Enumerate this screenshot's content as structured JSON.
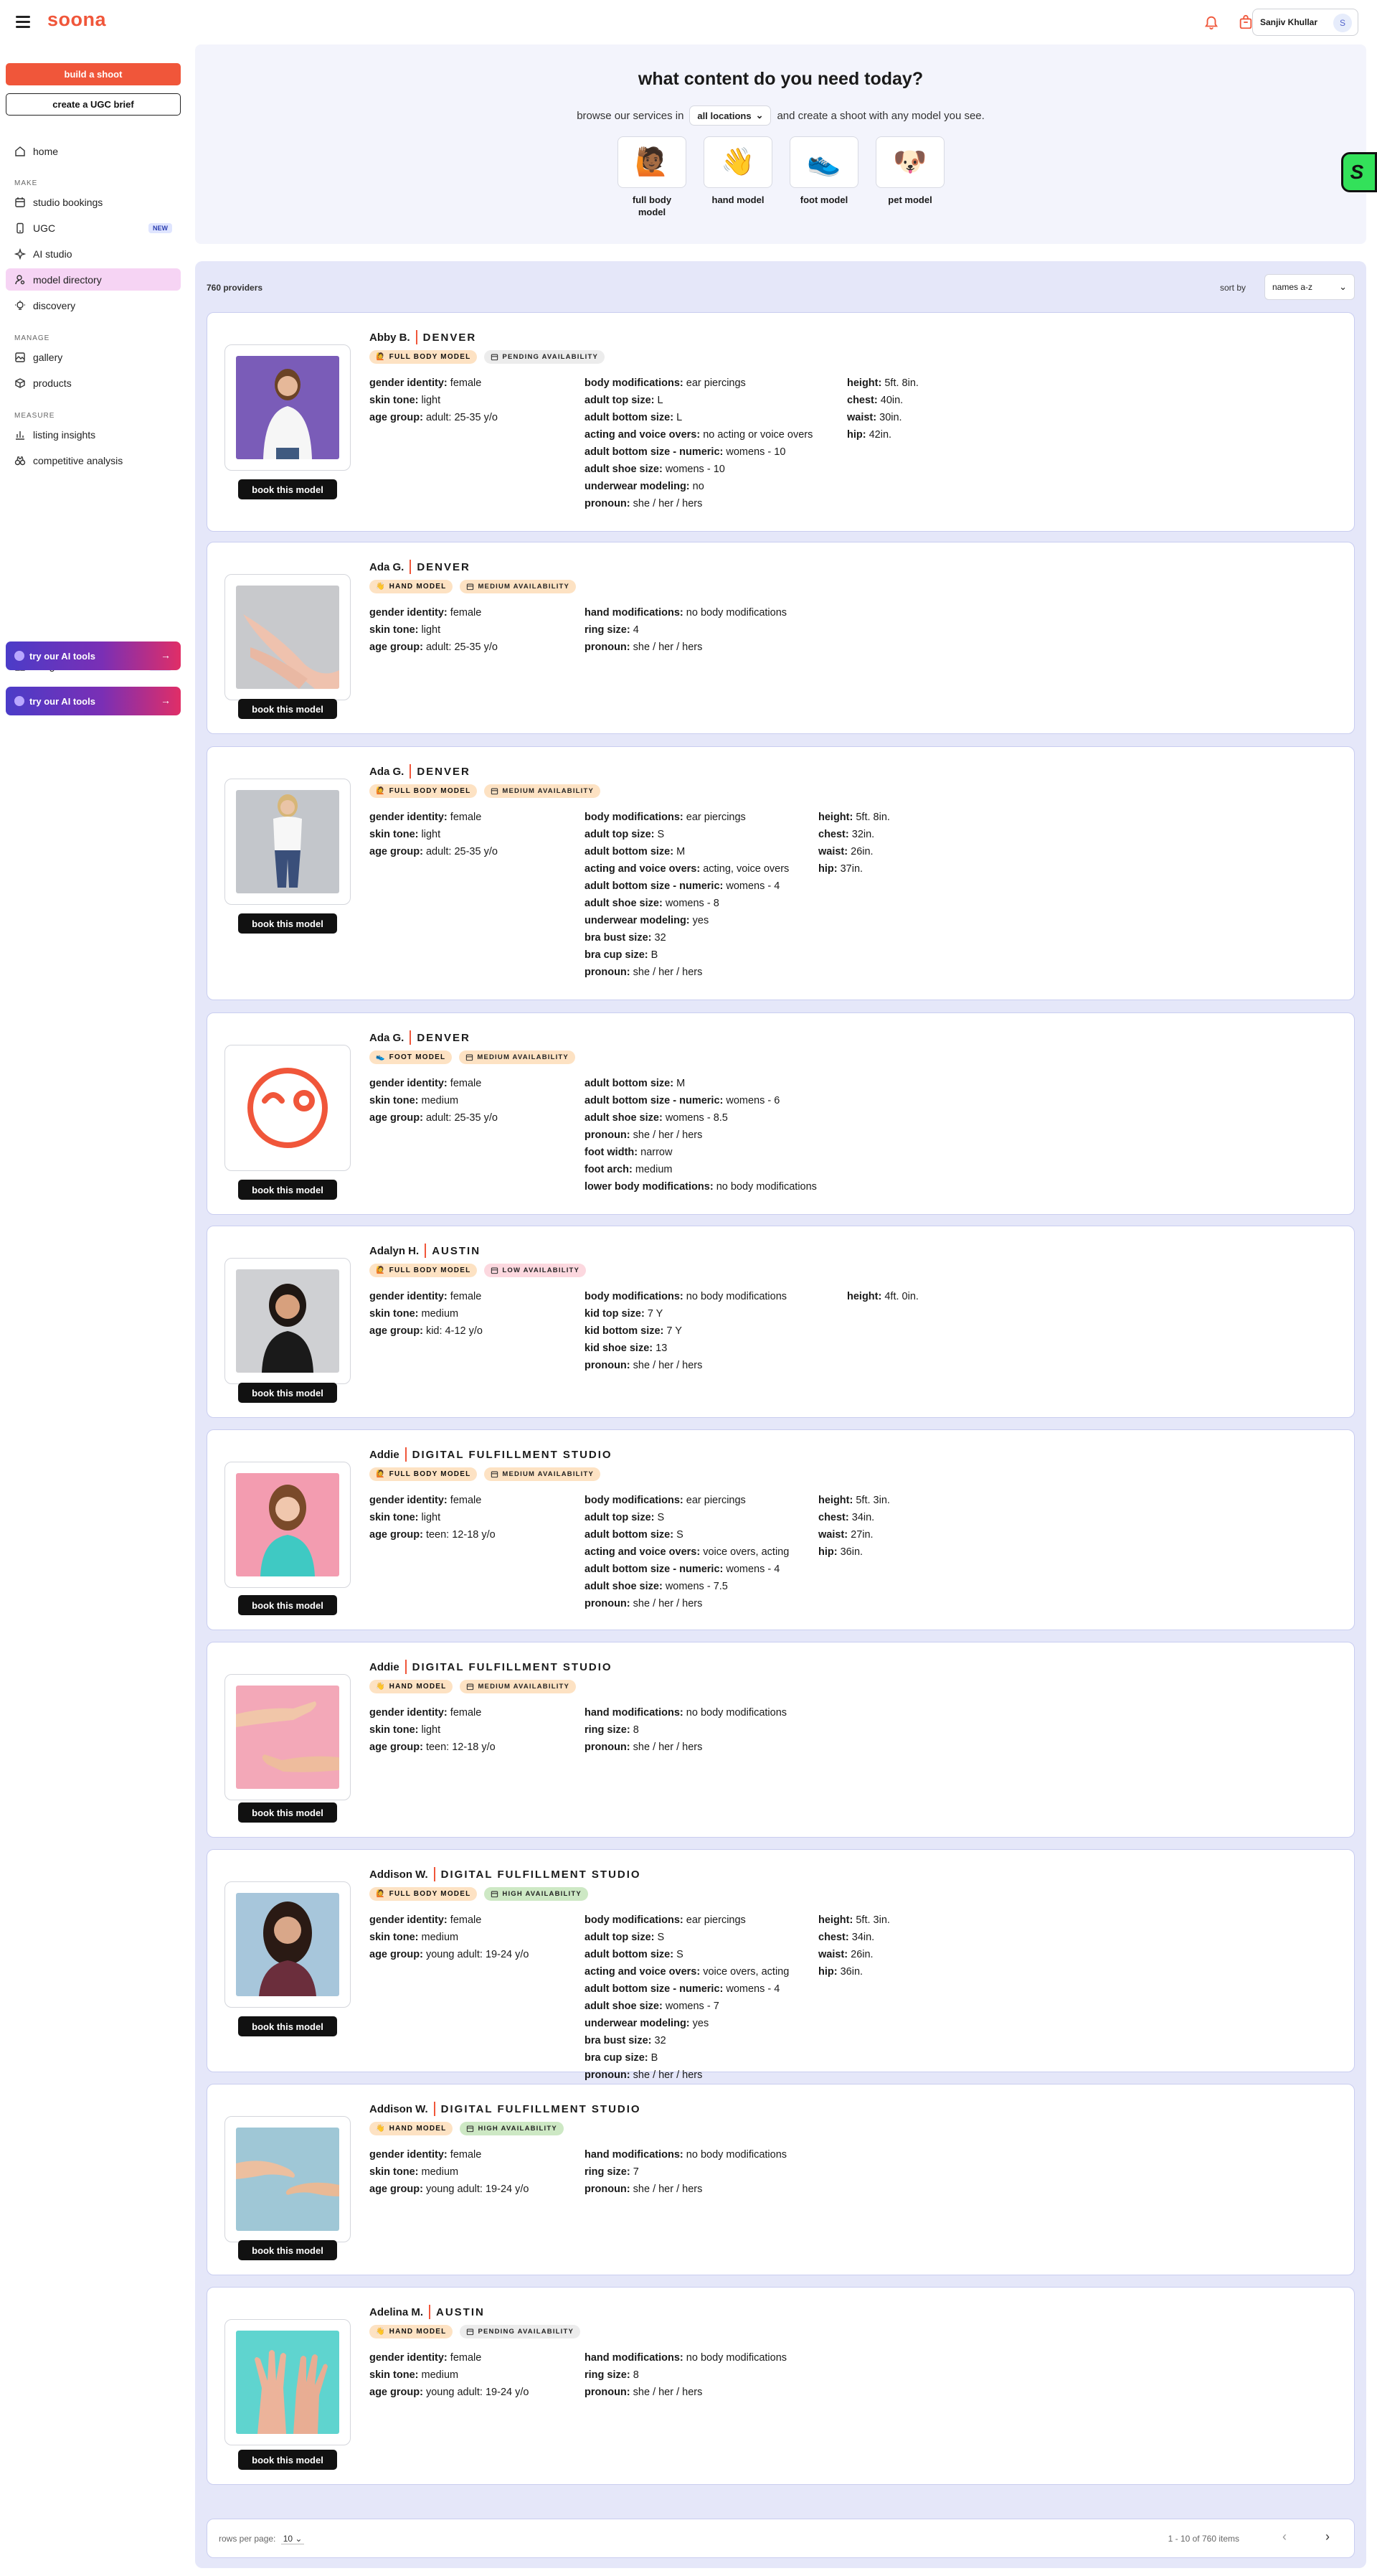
{
  "header": {
    "logo": "soona",
    "user_name": "Sanjiv Khullar",
    "user_initial": "S"
  },
  "sidebar": {
    "build_label": "build a shoot",
    "ugc_brief_label": "create a UGC brief",
    "home": "home",
    "sec_make": "MAKE",
    "studio_bookings": "studio bookings",
    "ugc": "UGC",
    "ai_studio": "AI studio",
    "model_directory": "model directory",
    "discovery": "discovery",
    "sec_manage": "MANAGE",
    "gallery": "gallery",
    "products": "products",
    "sec_measure": "MEASURE",
    "listing_insights": "listing insights",
    "competitive_analysis": "competitive analysis",
    "integrations": "integrations",
    "new_badge": "NEW",
    "ai_tools_1": "try our AI tools",
    "ai_tools_2": "try our AI tools"
  },
  "hero": {
    "title": "what content do you need today?",
    "line_before": "browse our services in",
    "location": "all locations",
    "line_after": "and create a shoot with any model you see.",
    "categories": [
      {
        "label": "full body model",
        "emoji": "🙋🏾"
      },
      {
        "label": "hand model",
        "emoji": "👋"
      },
      {
        "label": "foot model",
        "emoji": "👟"
      },
      {
        "label": "pet model",
        "emoji": "🐶"
      }
    ]
  },
  "results": {
    "count": "760 providers",
    "sort_label": "sort by",
    "sort_value": "names a-z",
    "book_label": "book this model"
  },
  "models": [
    {
      "name": "Abby B.",
      "location": "DENVER",
      "type": "FULL BODY MODEL",
      "type_icon": "🙋",
      "availability": "PENDING AVAILABILITY",
      "avail_class": "pending",
      "photo": "full-purple",
      "dots": "● ● ● ●",
      "col1": [
        [
          "gender identity:",
          "female"
        ],
        [
          "skin tone:",
          "light"
        ],
        [
          "age group:",
          "adult: 25-35 y/o"
        ]
      ],
      "col2": [
        [
          "body modifications:",
          "ear piercings"
        ],
        [
          "adult top size:",
          "L"
        ],
        [
          "adult bottom size:",
          "L"
        ],
        [
          "acting and voice overs:",
          "no acting or voice overs"
        ],
        [
          "adult bottom size - numeric:",
          "womens - 10"
        ],
        [
          "adult shoe size:",
          "womens - 10"
        ],
        [
          "underwear modeling:",
          "no"
        ],
        [
          "pronoun:",
          "she / her / hers"
        ]
      ],
      "col3": [
        [
          "height:",
          "5ft. 8in."
        ],
        [
          "chest:",
          "40in."
        ],
        [
          "waist:",
          "30in."
        ],
        [
          "hip:",
          "42in."
        ]
      ]
    },
    {
      "name": "Ada G.",
      "location": "DENVER",
      "type": "HAND MODEL",
      "type_icon": "👋",
      "availability": "MEDIUM AVAILABILITY",
      "avail_class": "medium",
      "photo": "hand-grey",
      "dots": "●",
      "col1": [
        [
          "gender identity:",
          "female"
        ],
        [
          "skin tone:",
          "light"
        ],
        [
          "age group:",
          "adult: 25-35 y/o"
        ]
      ],
      "col2": [
        [
          "hand modifications:",
          "no body modifications"
        ],
        [
          "ring size:",
          "4"
        ],
        [
          "pronoun:",
          "she / her / hers"
        ]
      ],
      "col3": []
    },
    {
      "name": "Ada G.",
      "location": "DENVER",
      "type": "FULL BODY MODEL",
      "type_icon": "🙋",
      "availability": "MEDIUM AVAILABILITY",
      "avail_class": "medium",
      "photo": "full-grey",
      "dots": "● ● ● ● ● ●",
      "col1": [
        [
          "gender identity:",
          "female"
        ],
        [
          "skin tone:",
          "light"
        ],
        [
          "age group:",
          "adult: 25-35 y/o"
        ]
      ],
      "col2": [
        [
          "body modifications:",
          "ear piercings"
        ],
        [
          "adult top size:",
          "S"
        ],
        [
          "adult bottom size:",
          "M"
        ],
        [
          "acting and voice overs:",
          "acting, voice overs"
        ],
        [
          "adult bottom size - numeric:",
          "womens - 4"
        ],
        [
          "adult shoe size:",
          "womens - 8"
        ],
        [
          "underwear modeling:",
          "yes"
        ],
        [
          "bra bust size:",
          "32"
        ],
        [
          "bra cup size:",
          "B"
        ],
        [
          "pronoun:",
          "she / her / hers"
        ]
      ],
      "col3": [
        [
          "height:",
          "5ft. 8in."
        ],
        [
          "chest:",
          "32in."
        ],
        [
          "waist:",
          "26in."
        ],
        [
          "hip:",
          "37in."
        ]
      ]
    },
    {
      "name": "Ada G.",
      "location": "DENVER",
      "type": "FOOT MODEL",
      "type_icon": "👟",
      "availability": "MEDIUM AVAILABILITY",
      "avail_class": "medium",
      "photo": "placeholder",
      "dots": "",
      "col1": [
        [
          "gender identity:",
          "female"
        ],
        [
          "skin tone:",
          "medium"
        ],
        [
          "age group:",
          "adult: 25-35 y/o"
        ]
      ],
      "col2": [
        [
          "adult bottom size:",
          "M"
        ],
        [
          "adult bottom size - numeric:",
          "womens - 6"
        ],
        [
          "adult shoe size:",
          "womens - 8.5"
        ],
        [
          "pronoun:",
          "she / her / hers"
        ],
        [
          "foot width:",
          "narrow"
        ],
        [
          "foot arch:",
          "medium"
        ],
        [
          "lower body modifications:",
          "no body modifications"
        ]
      ],
      "col3": []
    },
    {
      "name": "Adalyn H.",
      "location": "AUSTIN",
      "type": "FULL BODY MODEL",
      "type_icon": "🙋",
      "availability": "LOW AVAILABILITY",
      "avail_class": "low",
      "photo": "kid-grey",
      "dots": "● ● ● ● ●",
      "col1": [
        [
          "gender identity:",
          "female"
        ],
        [
          "skin tone:",
          "medium"
        ],
        [
          "age group:",
          "kid: 4-12 y/o"
        ]
      ],
      "col2": [
        [
          "body modifications:",
          "no body modifications"
        ],
        [
          "kid top size:",
          "7 Y"
        ],
        [
          "kid bottom size:",
          "7 Y"
        ],
        [
          "kid shoe size:",
          "13"
        ],
        [
          "pronoun:",
          "she / her / hers"
        ]
      ],
      "col3": [
        [
          "height:",
          "4ft. 0in."
        ]
      ]
    },
    {
      "name": "Addie",
      "location": "DIGITAL FULFILLMENT STUDIO",
      "type": "FULL BODY MODEL",
      "type_icon": "🙋",
      "availability": "MEDIUM AVAILABILITY",
      "avail_class": "medium",
      "photo": "teen-pink",
      "dots": "● ● ● ● ● ● ● ● ● ●",
      "col1": [
        [
          "gender identity:",
          "female"
        ],
        [
          "skin tone:",
          "light"
        ],
        [
          "age group:",
          "teen: 12-18 y/o"
        ]
      ],
      "col2": [
        [
          "body modifications:",
          "ear piercings"
        ],
        [
          "adult top size:",
          "S"
        ],
        [
          "adult bottom size:",
          "S"
        ],
        [
          "acting and voice overs:",
          "voice overs, acting"
        ],
        [
          "adult bottom size - numeric:",
          "womens - 4"
        ],
        [
          "adult shoe size:",
          "womens - 7.5"
        ],
        [
          "pronoun:",
          "she / her / hers"
        ]
      ],
      "col3": [
        [
          "height:",
          "5ft. 3in."
        ],
        [
          "chest:",
          "34in."
        ],
        [
          "waist:",
          "27in."
        ],
        [
          "hip:",
          "36in."
        ]
      ]
    },
    {
      "name": "Addie",
      "location": "DIGITAL FULFILLMENT STUDIO",
      "type": "HAND MODEL",
      "type_icon": "👋",
      "availability": "MEDIUM AVAILABILITY",
      "avail_class": "medium",
      "photo": "hand-pink",
      "dots": "● ● ●",
      "col1": [
        [
          "gender identity:",
          "female"
        ],
        [
          "skin tone:",
          "light"
        ],
        [
          "age group:",
          "teen: 12-18 y/o"
        ]
      ],
      "col2": [
        [
          "hand modifications:",
          "no body modifications"
        ],
        [
          "ring size:",
          "8"
        ],
        [
          "pronoun:",
          "she / her / hers"
        ]
      ],
      "col3": []
    },
    {
      "name": "Addison W.",
      "location": "DIGITAL FULFILLMENT STUDIO",
      "type": "FULL BODY MODEL",
      "type_icon": "🙋",
      "availability": "HIGH AVAILABILITY",
      "avail_class": "high",
      "photo": "young-blue",
      "dots": "● ● ● ● ●",
      "col1": [
        [
          "gender identity:",
          "female"
        ],
        [
          "skin tone:",
          "medium"
        ],
        [
          "age group:",
          "young adult: 19-24 y/o"
        ]
      ],
      "col2": [
        [
          "body modifications:",
          "ear piercings"
        ],
        [
          "adult top size:",
          "S"
        ],
        [
          "adult bottom size:",
          "S"
        ],
        [
          "acting and voice overs:",
          "voice overs, acting"
        ],
        [
          "adult bottom size - numeric:",
          "womens - 4"
        ],
        [
          "adult shoe size:",
          "womens - 7"
        ],
        [
          "underwear modeling:",
          "yes"
        ],
        [
          "bra bust size:",
          "32"
        ],
        [
          "bra cup size:",
          "B"
        ],
        [
          "pronoun:",
          "she / her / hers"
        ]
      ],
      "col3": [
        [
          "height:",
          "5ft. 3in."
        ],
        [
          "chest:",
          "34in."
        ],
        [
          "waist:",
          "26in."
        ],
        [
          "hip:",
          "36in."
        ]
      ]
    },
    {
      "name": "Addison W.",
      "location": "DIGITAL FULFILLMENT STUDIO",
      "type": "HAND MODEL",
      "type_icon": "👋",
      "availability": "HIGH AVAILABILITY",
      "avail_class": "high",
      "photo": "hand-blue",
      "dots": "● ● ●",
      "col1": [
        [
          "gender identity:",
          "female"
        ],
        [
          "skin tone:",
          "medium"
        ],
        [
          "age group:",
          "young adult: 19-24 y/o"
        ]
      ],
      "col2": [
        [
          "hand modifications:",
          "no body modifications"
        ],
        [
          "ring size:",
          "7"
        ],
        [
          "pronoun:",
          "she / her / hers"
        ]
      ],
      "col3": []
    },
    {
      "name": "Adelina M.",
      "location": "AUSTIN",
      "type": "HAND MODEL",
      "type_icon": "👋",
      "availability": "PENDING AVAILABILITY",
      "avail_class": "pending",
      "photo": "hand-teal",
      "dots": "● ● ● ● ● ●",
      "col1": [
        [
          "gender identity:",
          "female"
        ],
        [
          "skin tone:",
          "medium"
        ],
        [
          "age group:",
          "young adult: 19-24 y/o"
        ]
      ],
      "col2": [
        [
          "hand modifications:",
          "no body modifications"
        ],
        [
          "ring size:",
          "8"
        ],
        [
          "pronoun:",
          "she / her / hers"
        ]
      ],
      "col3": []
    }
  ],
  "pagination": {
    "rows_label": "rows per page:",
    "rows_value": "10",
    "range": "1 - 10 of 760 items"
  }
}
